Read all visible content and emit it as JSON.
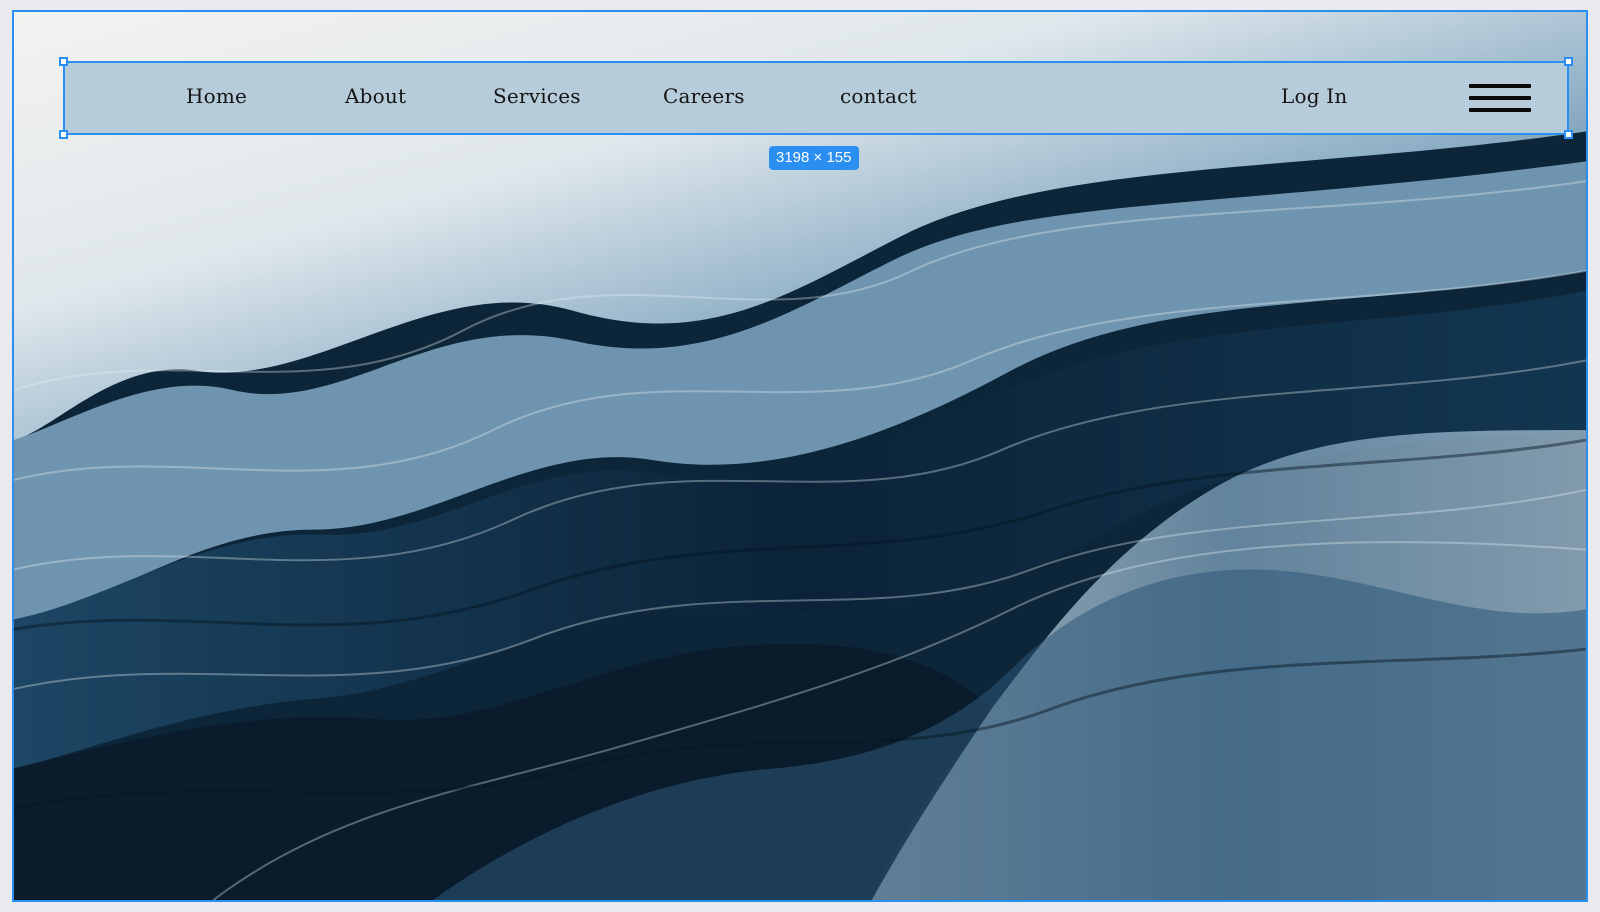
{
  "colors": {
    "selection_accent": "#2a8ff0",
    "navbar_bg": "#b7ccdb",
    "nav_text": "#141414"
  },
  "navbar": {
    "links": [
      {
        "label": "Home"
      },
      {
        "label": "About"
      },
      {
        "label": "Services"
      },
      {
        "label": "Careers"
      },
      {
        "label": "contact"
      }
    ],
    "login_label": "Log In",
    "menu_icon": "hamburger-menu-icon"
  },
  "selection": {
    "size_badge": "3198 × 155"
  },
  "background": {
    "description_icon": "abstract-wave-art"
  }
}
